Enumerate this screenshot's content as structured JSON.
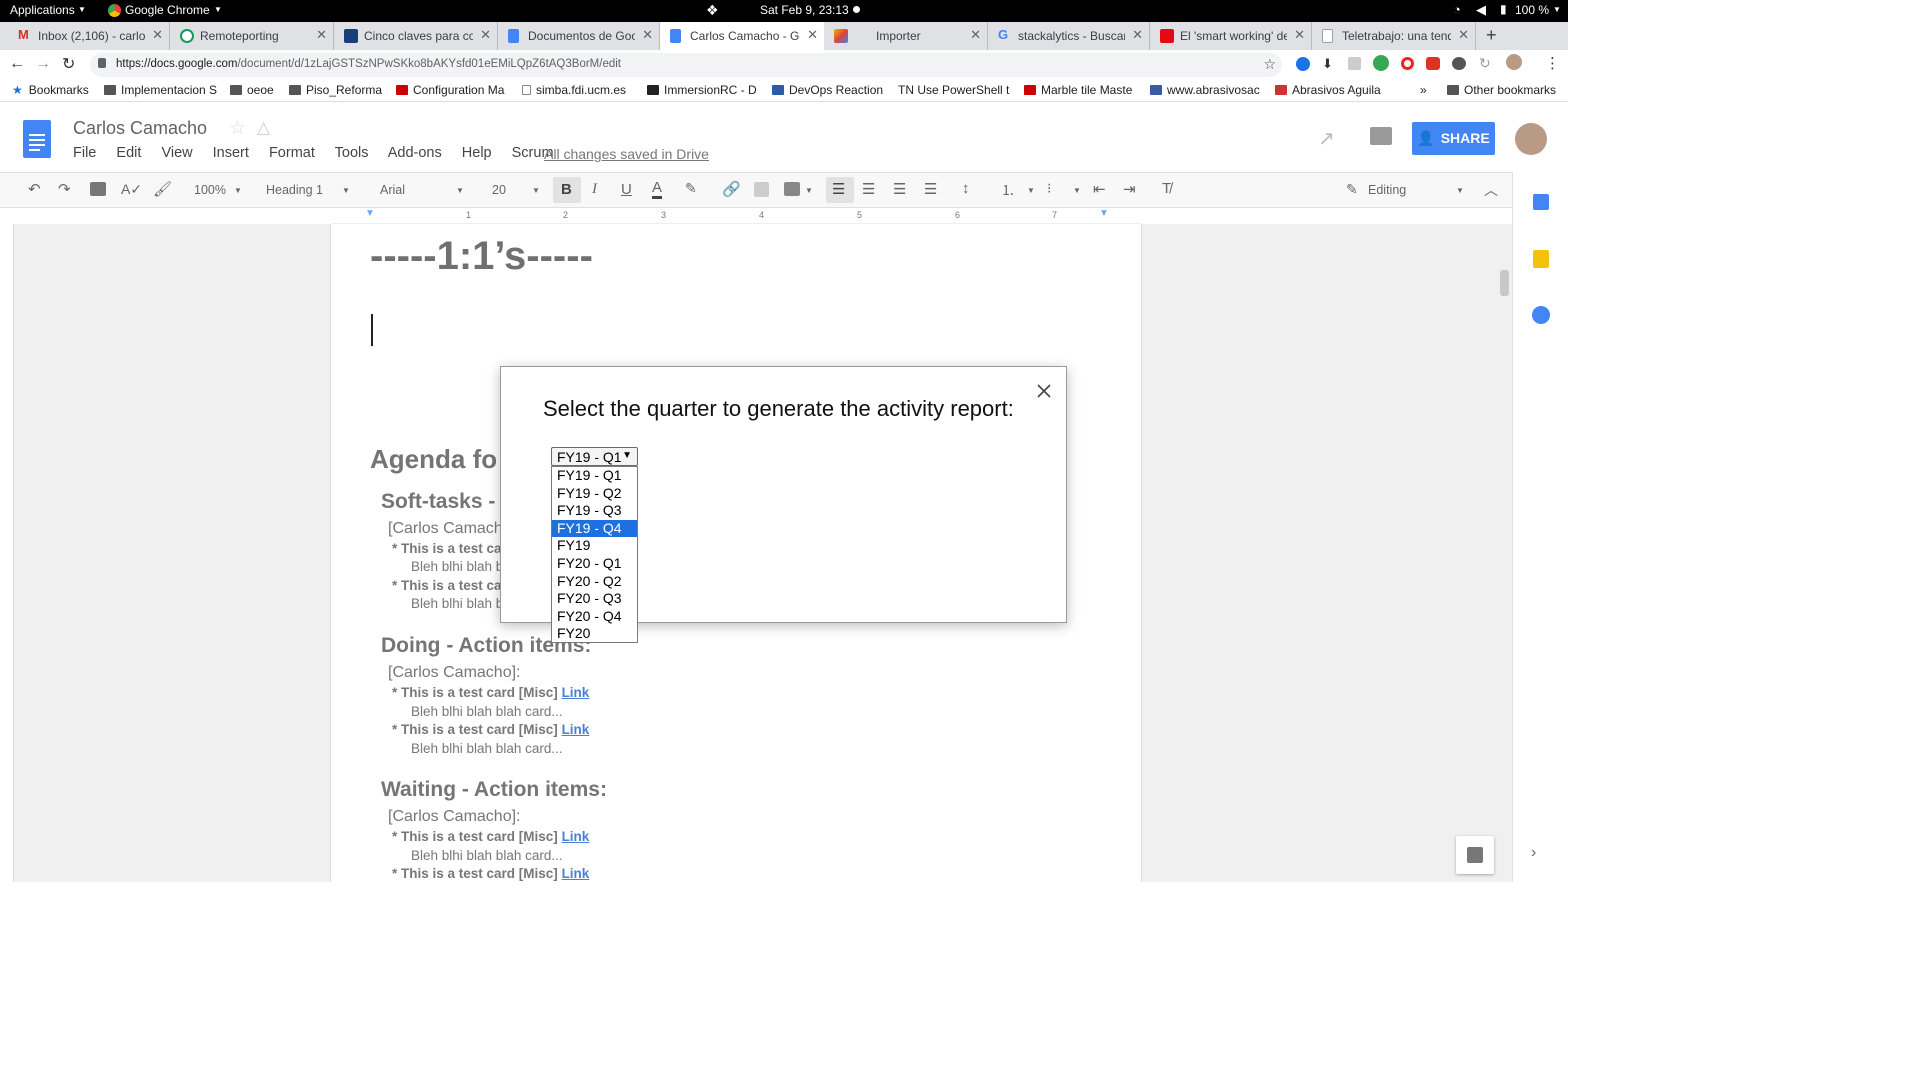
{
  "sysbar": {
    "applications": "Applications",
    "browser": "Google Chrome",
    "clock": "Sat Feb  9, 23:13",
    "battery": "100 %"
  },
  "tabs": [
    {
      "title": "Inbox (2,106) - carlo",
      "color": "#d93025"
    },
    {
      "title": "Remoteporting",
      "color": "#0f9d58"
    },
    {
      "title": "Cinco claves para co",
      "color": "#1a3d7c"
    },
    {
      "title": "Documentos de Goo",
      "color": "#4285f4"
    },
    {
      "title": "Carlos Camacho - Go",
      "color": "#4285f4"
    },
    {
      "title": "Importer",
      "color": "#f4b400"
    },
    {
      "title": "stackalytics - Buscar",
      "color": "#4285f4"
    },
    {
      "title": "El 'smart working' de",
      "color": "#e50914"
    },
    {
      "title": "Teletrabajo: una tend",
      "color": "#9aa0a6"
    }
  ],
  "address": {
    "host": "https://docs.google.com",
    "path": "/document/d/1zLajGSTSzNPwSKko8bAKYsfd01eEMiLQpZ6tAQ3BorM/edit"
  },
  "bookmarks": [
    {
      "label": "Bookmarks"
    },
    {
      "label": "Implementacion S"
    },
    {
      "label": "oeoe"
    },
    {
      "label": "Piso_Reforma"
    },
    {
      "label": "Configuration Ma"
    },
    {
      "label": "simba.fdi.ucm.es"
    },
    {
      "label": "ImmersionRC - D"
    },
    {
      "label": "DevOps Reaction"
    },
    {
      "label": "TN  Use PowerShell t"
    },
    {
      "label": "Marble tile Maste"
    },
    {
      "label": "www.abrasivosac"
    },
    {
      "label": "Abrasivos Aguila"
    }
  ],
  "bookmarks_more": "»",
  "other_bookmarks": "Other bookmarks",
  "docs": {
    "title": "Carlos Camacho",
    "menu": [
      "File",
      "Edit",
      "View",
      "Insert",
      "Format",
      "Tools",
      "Add-ons",
      "Help",
      "Scrum"
    ],
    "saved": "All changes saved in Drive",
    "share": "SHARE"
  },
  "toolbar": {
    "zoom": "100%",
    "style": "Heading 1",
    "font": "Arial",
    "size": "20",
    "mode": "Editing"
  },
  "ruler_numbers": [
    "1",
    "2",
    "3",
    "4",
    "5",
    "6",
    "7"
  ],
  "content": {
    "h_top": "-----1:1’s-----",
    "agenda": "Agenda fo",
    "soft_title": "Soft-tasks -",
    "soft_who": "[Carlos Camach",
    "soft_card1": "* This is a test ca",
    "soft_desc1": "Bleh blhi blah b",
    "soft_card2": "* This is a test ca",
    "soft_desc2": "Bleh blhi blah b",
    "doing_title": "Doing - Action items:",
    "who": "[Carlos Camacho]:",
    "card_text": "* This is a test card  [Misc] ",
    "link": "Link",
    "desc": "Bleh blhi blah blah card...",
    "waiting_title": "Waiting - Action items:"
  },
  "modal": {
    "title": "Select the quarter to generate the activity report:",
    "selected": "FY19 - Q1",
    "options": [
      "FY19 - Q1",
      "FY19 - Q2",
      "FY19 - Q3",
      "FY19 - Q4",
      "FY19",
      "FY20 - Q1",
      "FY20 - Q2",
      "FY20 - Q3",
      "FY20 - Q4",
      "FY20"
    ],
    "highlighted": "FY19 - Q4"
  }
}
